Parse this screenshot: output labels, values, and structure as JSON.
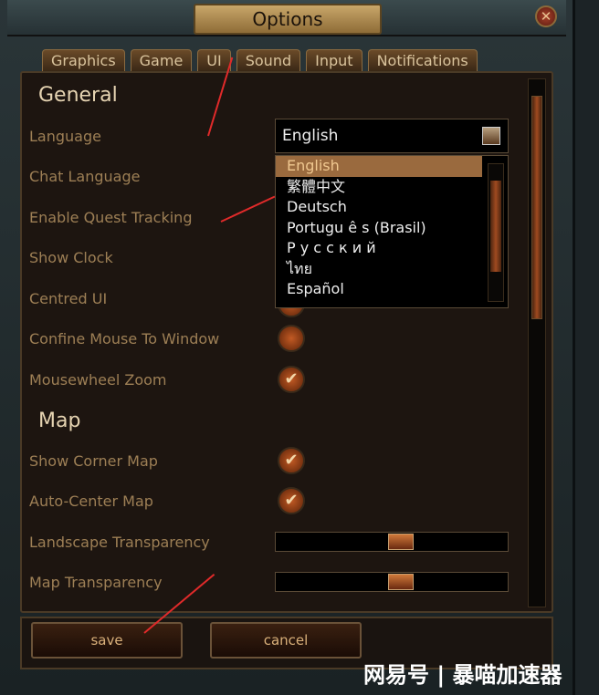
{
  "window": {
    "title": "Options",
    "close_icon": "close-icon"
  },
  "tabs": [
    {
      "label": "Graphics"
    },
    {
      "label": "Game"
    },
    {
      "label": "UI",
      "active": true
    },
    {
      "label": "Sound"
    },
    {
      "label": "Input"
    },
    {
      "label": "Notifications"
    }
  ],
  "general": {
    "heading": "General",
    "language": {
      "label": "Language",
      "value": "English",
      "options": [
        "English",
        "繁體中文",
        "Deutsch",
        "Portugu ê s (Brasil)",
        "Р у с с к и й",
        "ไทย",
        "Español"
      ]
    },
    "chat_language": {
      "label": "Chat Language"
    },
    "enable_quest_tracking": {
      "label": "Enable Quest Tracking"
    },
    "show_clock": {
      "label": "Show Clock"
    },
    "centred_ui": {
      "label": "Centred UI"
    },
    "confine_mouse": {
      "label": "Confine Mouse To Window",
      "checked": false
    },
    "mousewheel_zoom": {
      "label": "Mousewheel Zoom",
      "checked": true
    }
  },
  "map": {
    "heading": "Map",
    "show_corner_map": {
      "label": "Show Corner Map",
      "checked": true
    },
    "auto_center_map": {
      "label": "Auto-Center Map",
      "checked": true
    },
    "landscape_transparency": {
      "label": "Landscape Transparency",
      "value_percent": 50
    },
    "map_transparency": {
      "label": "Map Transparency",
      "value_percent": 50
    }
  },
  "buttons": {
    "save": "save",
    "cancel": "cancel"
  },
  "watermark": "网易号 | 暴喵加速器",
  "colors": {
    "accent": "#9a6a3e",
    "label": "#9d7f55",
    "annotation_arrow": "#e02a2a"
  }
}
